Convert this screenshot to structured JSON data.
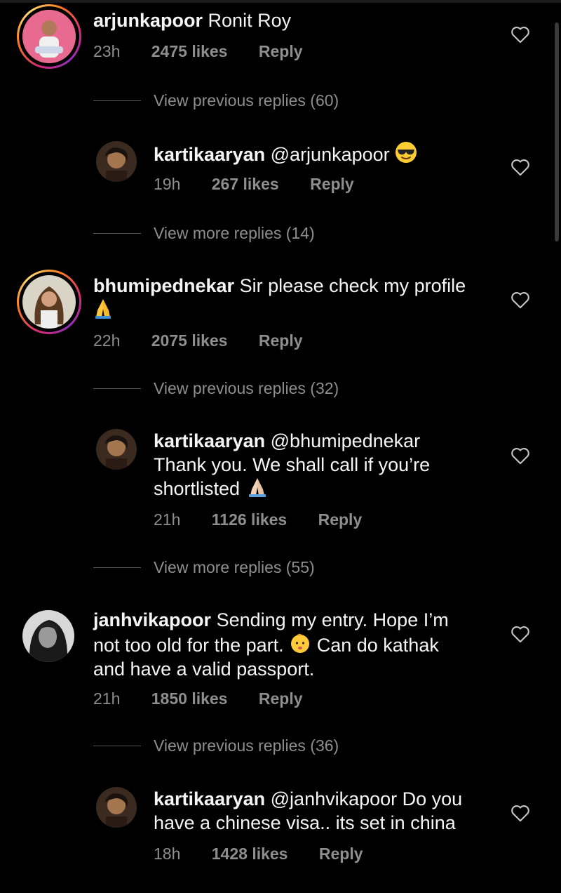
{
  "threads": [
    {
      "comment": {
        "username": "arjunkapoor",
        "text": "Ronit Roy",
        "time": "23h",
        "likes": "2475 likes",
        "reply_label": "Reply"
      },
      "previous_replies": "View previous replies (60)",
      "reply": {
        "username": "kartikaaryan",
        "text": "@arjunkapoor",
        "emoji": "sunglasses-emoji",
        "time": "19h",
        "likes": "267 likes",
        "reply_label": "Reply"
      },
      "more_replies": "View more replies (14)"
    },
    {
      "comment": {
        "username": "bhumipednekar",
        "text": "Sir please check my profile",
        "emoji": "folded-hands-emoji",
        "time": "22h",
        "likes": "2075 likes",
        "reply_label": "Reply"
      },
      "previous_replies": "View previous replies (32)",
      "reply": {
        "username": "kartikaaryan",
        "text_line1": "@bhumipednekar",
        "text_line2": "Thank you. We shall call if you’re",
        "text_line3": "shortlisted",
        "emoji": "folded-hands-emoji",
        "time": "21h",
        "likes": "1126 likes",
        "reply_label": "Reply"
      },
      "more_replies": "View more replies (55)"
    },
    {
      "comment": {
        "username": "janhvikapoor",
        "text_line1": "Sending my entry. Hope I’m",
        "text_line2a": "not too old for the part.",
        "text_line2b": "Can do kathak",
        "text_line3": "and have a valid passport.",
        "emoji": "baby-emoji",
        "time": "21h",
        "likes": "1850 likes",
        "reply_label": "Reply"
      },
      "previous_replies": "View previous replies (36)",
      "reply": {
        "username": "kartikaaryan",
        "text_line1": "@janhvikapoor Do you",
        "text_line2": "have a chinese visa.. its set in china",
        "time": "18h",
        "likes": "1428 likes",
        "reply_label": "Reply"
      }
    }
  ],
  "colors": {
    "background": "#000000",
    "text": "#f5f5f5",
    "muted": "#8e8e8e",
    "story_ring": "#d62976"
  }
}
